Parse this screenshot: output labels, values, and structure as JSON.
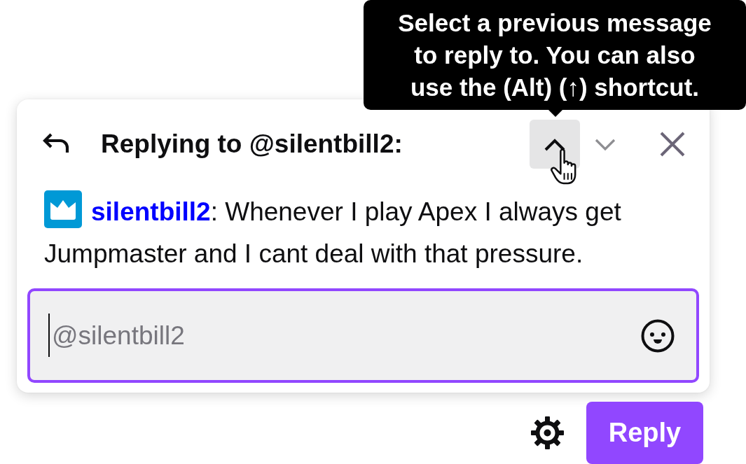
{
  "tooltip": {
    "text": "Select a previous message to reply to. You can also use the (Alt) (↑) shortcut."
  },
  "reply_panel": {
    "title": "Replying to @silentbill2:",
    "nav_buttons": [
      {
        "kind": "previous",
        "hovered": true,
        "disabled": false
      },
      {
        "kind": "next",
        "hovered": false,
        "disabled": true
      }
    ],
    "message": {
      "author": "silentbill2",
      "text": ": Whenever I play Apex I always get Jumpmaster and I cant deal with that pressure."
    }
  },
  "chat_input": {
    "placeholder": "@silentbill2",
    "focused": true
  },
  "footer": {
    "button": "Reply"
  }
}
